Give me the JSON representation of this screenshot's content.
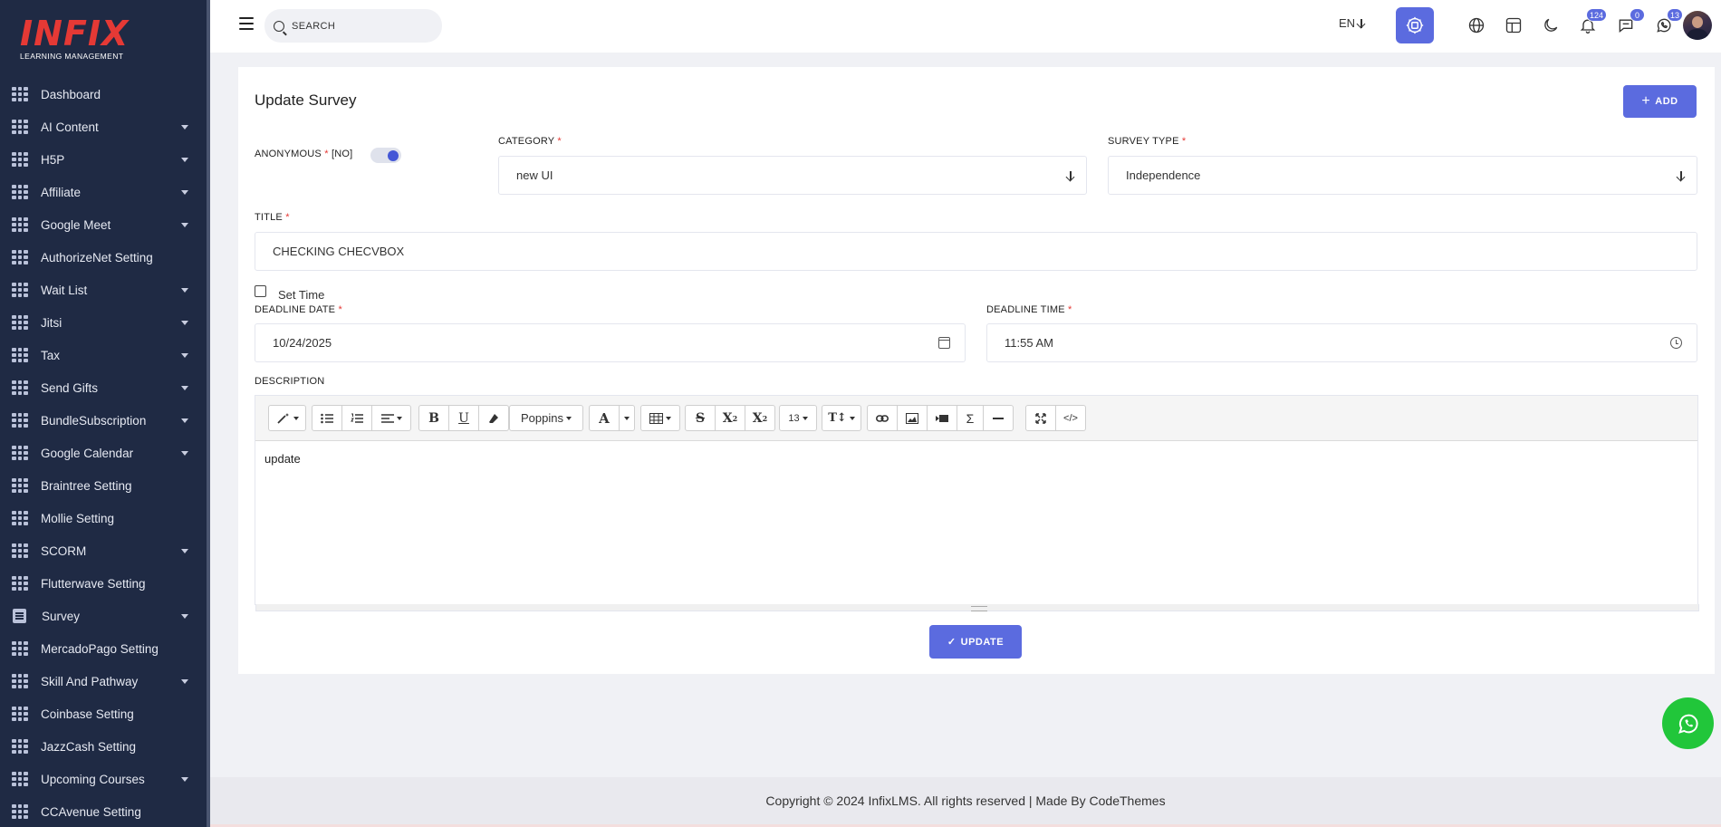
{
  "logo": {
    "main": "INFIX",
    "sub": "LEARNING MANAGEMENT"
  },
  "sidebar": {
    "items": [
      {
        "label": "Dashboard",
        "caret": false,
        "icon": "grid-icon"
      },
      {
        "label": "AI Content",
        "caret": true,
        "icon": "grid-icon"
      },
      {
        "label": "H5P",
        "caret": true,
        "icon": "grid-icon"
      },
      {
        "label": "Affiliate",
        "caret": true,
        "icon": "grid-icon"
      },
      {
        "label": "Google Meet",
        "caret": true,
        "icon": "grid-icon"
      },
      {
        "label": "AuthorizeNet Setting",
        "caret": false,
        "icon": "grid-icon"
      },
      {
        "label": "Wait List",
        "caret": true,
        "icon": "grid-icon"
      },
      {
        "label": "Jitsi",
        "caret": true,
        "icon": "grid-icon"
      },
      {
        "label": "Tax",
        "caret": true,
        "icon": "grid-icon"
      },
      {
        "label": "Send Gifts",
        "caret": true,
        "icon": "grid-icon"
      },
      {
        "label": "BundleSubscription",
        "caret": true,
        "icon": "grid-icon"
      },
      {
        "label": "Google Calendar",
        "caret": true,
        "icon": "grid-icon"
      },
      {
        "label": "Braintree Setting",
        "caret": false,
        "icon": "grid-icon"
      },
      {
        "label": "Mollie Setting",
        "caret": false,
        "icon": "grid-icon"
      },
      {
        "label": "SCORM",
        "caret": true,
        "icon": "grid-icon"
      },
      {
        "label": "Flutterwave Setting",
        "caret": false,
        "icon": "grid-icon"
      },
      {
        "label": "Survey",
        "caret": true,
        "icon": "document-icon"
      },
      {
        "label": "MercadoPago Setting",
        "caret": false,
        "icon": "grid-icon"
      },
      {
        "label": "Skill And Pathway",
        "caret": true,
        "icon": "grid-icon"
      },
      {
        "label": "Coinbase Setting",
        "caret": false,
        "icon": "grid-icon"
      },
      {
        "label": "JazzCash Setting",
        "caret": false,
        "icon": "grid-icon"
      },
      {
        "label": "Upcoming Courses",
        "caret": true,
        "icon": "grid-icon"
      },
      {
        "label": "CCAvenue Setting",
        "caret": false,
        "icon": "grid-icon"
      }
    ]
  },
  "header": {
    "search_placeholder": "SEARCH",
    "language": "EN",
    "notifications_count": "124",
    "messages_count": "0",
    "whatsapp_count": "13",
    "accent_color": "#5b6bdf"
  },
  "form": {
    "page_title": "Update Survey",
    "add_label": "ADD",
    "anonymous_label": "ANONYMOUS",
    "anonymous_state": "[NO]",
    "category_label": "CATEGORY",
    "category_value": "new UI",
    "survey_type_label": "SURVEY TYPE",
    "survey_type_value": "Independence",
    "title_label": "TITLE",
    "title_value": "CHECKING CHECVBOX",
    "set_time_label": "Set Time",
    "deadline_date_label": "DEADLINE DATE",
    "deadline_date_value": "10/24/2025",
    "deadline_time_label": "DEADLINE TIME",
    "deadline_time_value": "11:55 AM",
    "description_label": "DESCRIPTION",
    "font_name": "Poppins",
    "font_size": "13",
    "description_value": "update",
    "update_label": "UPDATE",
    "required_mark": "*"
  },
  "footer": {
    "text": "Copyright © 2024 InfixLMS. All rights reserved | Made By CodeThemes"
  }
}
